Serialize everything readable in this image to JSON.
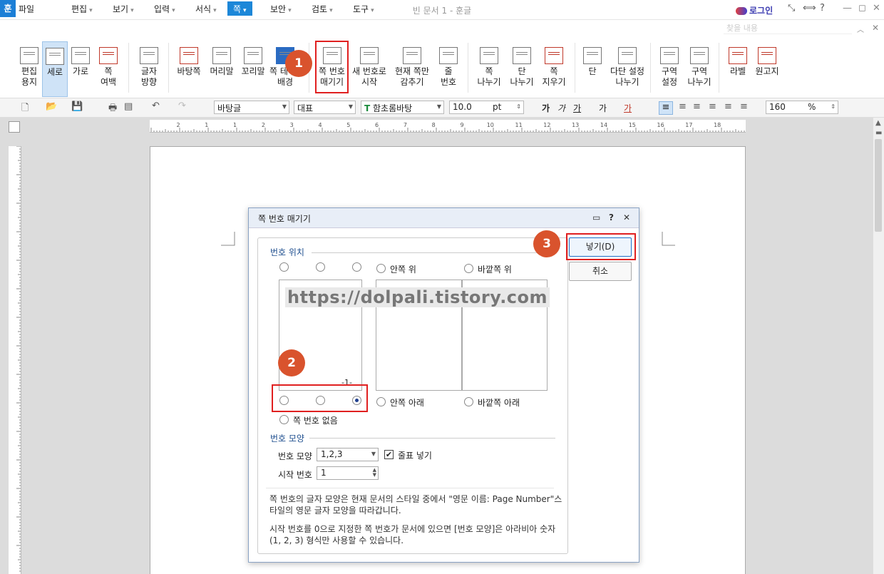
{
  "app": {
    "logo": "훈",
    "title": "빈 문서 1 - 훈글",
    "login": "로그인"
  },
  "titlebar_icons": [
    "⤡",
    "⟺",
    "?",
    "—",
    "◻",
    "✕"
  ],
  "menubar": {
    "file": "파일",
    "items": [
      "편집",
      "보기",
      "입력",
      "서식",
      "쪽",
      "보안",
      "검토",
      "도구"
    ],
    "active": "쪽",
    "search_placeholder": "찾을 내용"
  },
  "ribbon": {
    "items": [
      {
        "label": "편집\n용지",
        "icon": "page-setup-icon"
      },
      {
        "label": "세로",
        "icon": "portrait-icon"
      },
      {
        "label": "가로",
        "icon": "landscape-icon"
      },
      {
        "label": "쪽\n여백",
        "icon": "margin-icon"
      },
      {
        "label": "글자\n방향",
        "icon": "text-direction-icon"
      },
      {
        "label": "바탕쪽",
        "icon": "master-page-icon"
      },
      {
        "label": "머리말",
        "icon": "header-icon"
      },
      {
        "label": "꼬리말",
        "icon": "footer-icon"
      },
      {
        "label": "쪽 테두리\n배경",
        "icon": "page-border-icon"
      },
      {
        "label": "쪽 번호\n매기기",
        "icon": "page-number-icon"
      },
      {
        "label": "새 번호로\n시작",
        "icon": "new-number-icon"
      },
      {
        "label": "현재 쪽만\n감추기",
        "icon": "hide-icon"
      },
      {
        "label": "줄\n번호",
        "icon": "line-number-icon"
      },
      {
        "label": "쪽\n나누기",
        "icon": "page-break-icon"
      },
      {
        "label": "단\n나누기",
        "icon": "column-break-icon"
      },
      {
        "label": "쪽\n지우기",
        "icon": "delete-page-icon"
      },
      {
        "label": "단",
        "icon": "columns-icon"
      },
      {
        "label": "다단 설정\n나누기",
        "icon": "multi-column-icon"
      },
      {
        "label": "구역\n설정",
        "icon": "section-setup-icon"
      },
      {
        "label": "구역\n나누기",
        "icon": "section-break-icon"
      },
      {
        "label": "라벨",
        "icon": "label-icon"
      },
      {
        "label": "원고지",
        "icon": "manuscript-icon"
      }
    ]
  },
  "toolbar2": {
    "style": "바탕글",
    "lang": "대표",
    "font": "함초롬바탕",
    "size": "10.0",
    "unit": "pt",
    "zoom": "160",
    "zoom_unit": "%",
    "char_buttons": [
      "가",
      "가",
      "가",
      "가",
      "가"
    ]
  },
  "ruler_numbers": [
    "2",
    "1",
    "1",
    "2",
    "3",
    "4",
    "5",
    "6",
    "7",
    "8",
    "9",
    "10",
    "11",
    "12",
    "13",
    "14",
    "15",
    "16",
    "17",
    "18"
  ],
  "dialog": {
    "title": "쪽 번호 매기기",
    "section_position": "번호 위치",
    "opt_inside_top": "안쪽 위",
    "opt_outside_top": "바깥쪽 위",
    "opt_inside_bottom": "안쪽 아래",
    "opt_outside_bottom": "바깥쪽 아래",
    "opt_none": "쪽 번호 없음",
    "preview_number": "-1-",
    "section_format": "번호 모양",
    "format_label": "번호 모양",
    "format_value": "1,2,3",
    "include_dash_label": "줄표 넣기",
    "include_dash_checked": true,
    "start_label": "시작 번호",
    "start_value": "1",
    "note1_line1": "쪽 번호의 글자 모양은 현재 문서의 스타일 중에서 \"영문 이름: Page Number\"스",
    "note1_line2": "타일의 영문 글자 모양을 따라갑니다.",
    "note2_line1": "시작 번호를 0으로 지정한 쪽 번호가 문서에 있으면 [번호 모양]은 아라비아 숫자",
    "note2_line2": "(1, 2, 3) 형식만 사용할 수 있습니다.",
    "insert_button": "넣기(D)",
    "cancel_button": "취소"
  },
  "annotations": {
    "badge1": "1",
    "badge2": "2",
    "badge3": "3",
    "watermark": "https://dolpali.tistory.com"
  }
}
